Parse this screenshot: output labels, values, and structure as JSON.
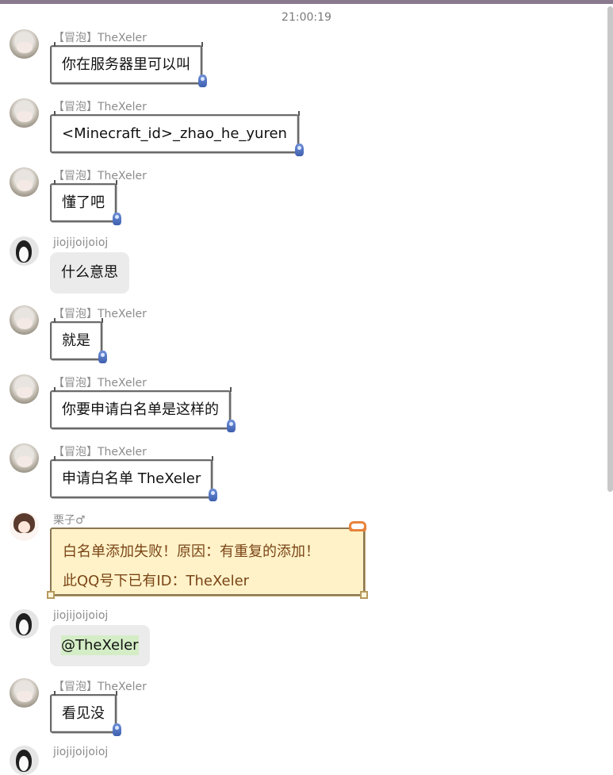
{
  "timestamp": "21:00:19",
  "messages": [
    {
      "sender": "【冒泡】TheXeler",
      "text": "你在服务器里可以叫"
    },
    {
      "sender": "【冒泡】TheXeler",
      "text": "<Minecraft_id>_zhao_he_yuren"
    },
    {
      "sender": "【冒泡】TheXeler",
      "text": "懂了吧"
    },
    {
      "sender": "jiojijoijoioj",
      "text": "什么意思"
    },
    {
      "sender": "【冒泡】TheXeler",
      "text": "就是"
    },
    {
      "sender": "【冒泡】TheXeler",
      "text": "你要申请白名单是这样的"
    },
    {
      "sender": "【冒泡】TheXeler",
      "text": "申请白名单 TheXeler"
    },
    {
      "sender": "栗子♂",
      "lines": [
        "白名单添加失败！原因：有重复的添加！",
        "此QQ号下已有ID：TheXeler"
      ]
    },
    {
      "sender": "jiojijoijoioj",
      "mention": "@TheXeler"
    },
    {
      "sender": "【冒泡】TheXeler",
      "text": "看见没"
    },
    {
      "sender": "jiojijoijoioj"
    }
  ],
  "colors": {
    "topbar": "#8a7a8e",
    "bot_bubble_bg": "#fff2c9",
    "bot_text": "#7a4516",
    "gray_bubble": "#ebebeb",
    "mention_bg": "#d4edc6"
  }
}
